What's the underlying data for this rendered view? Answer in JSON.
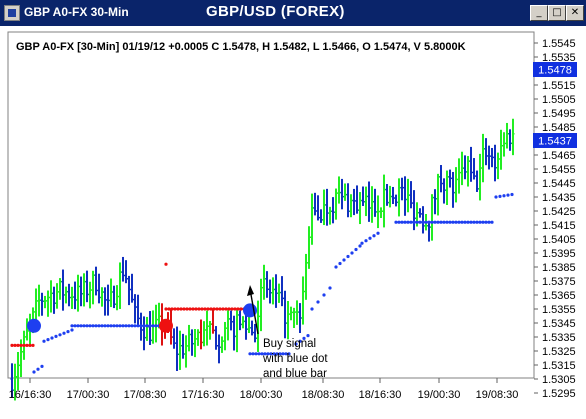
{
  "window": {
    "title": "GBP A0-FX 30-Min",
    "chart_title": "GBP/USD (FOREX)",
    "buttons": {
      "minimize": "_",
      "maximize": "□",
      "close": "✕"
    }
  },
  "info_line": "GBP A0-FX [30-Min] 01/19/12 +0.0005 C 1.5478, H 1.5482, L 1.5466, O 1.5474, V 5.8000K",
  "annotation": {
    "line1": "Buy signal",
    "line2": "with blue dot",
    "line3": "and blue bar"
  },
  "price_tags": {
    "last": "1.5478",
    "stop": "1.5437"
  },
  "colors": {
    "up_bar": "#22ee22",
    "down_bar": "#1030c0",
    "sell_bar": "#dd1111",
    "buy_dot": "#1e3ff0",
    "sell_dot": "#ee1111",
    "tag_bg": "#1030e0"
  },
  "chart_data": {
    "type": "ohlc",
    "x_tick_labels": [
      "16/16:30",
      "17/00:30",
      "17/08:30",
      "17/16:30",
      "18/00:30",
      "18/08:30",
      "18/16:30",
      "19/00:30",
      "19/08:30"
    ],
    "y_tick_labels": [
      "1.5545",
      "1.5535",
      "1.5525",
      "1.5515",
      "1.5505",
      "1.5495",
      "1.5485",
      "1.5475",
      "1.5465",
      "1.5455",
      "1.5445",
      "1.5435",
      "1.5425",
      "1.5415",
      "1.5405",
      "1.5395",
      "1.5385",
      "1.5375",
      "1.5365",
      "1.5355",
      "1.5345",
      "1.5335",
      "1.5325",
      "1.5315",
      "1.5305",
      "1.5295"
    ],
    "ylim": [
      1.5295,
      1.555
    ],
    "last_price": 1.5478,
    "trailing_stop": 1.5437,
    "big_signal_dots": [
      {
        "type": "buy",
        "price": 1.5343
      },
      {
        "type": "sell",
        "price": 1.5343
      },
      {
        "type": "buy",
        "price": 1.5354
      }
    ],
    "trail_segments": [
      {
        "color": "red",
        "price": 1.5329,
        "from": "16/16:30",
        "to": "16/16:30"
      },
      {
        "color": "red",
        "price": 1.5355,
        "from": "17/16:30",
        "to": "17/16:30"
      },
      {
        "color": "blue",
        "price": 1.5417,
        "from": "18/16:30",
        "to": "19/08:30"
      }
    ]
  }
}
